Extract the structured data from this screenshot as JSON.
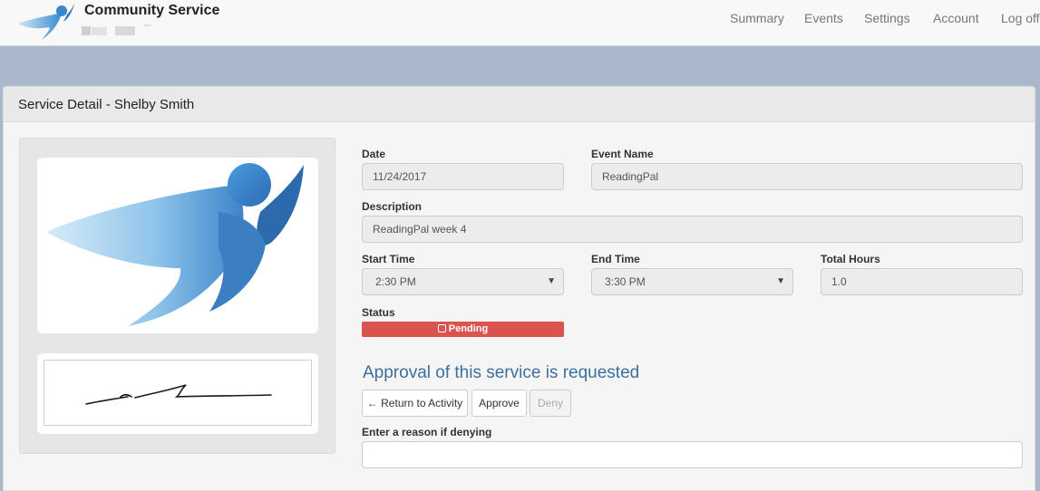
{
  "header": {
    "app_title": "Community Service",
    "logo_icon": "flying-figure-logo",
    "nav": [
      "Summary",
      "Events",
      "Settings",
      "Account",
      "Log off"
    ]
  },
  "panel": {
    "title": "Service Detail - Shelby Smith"
  },
  "form": {
    "date_label": "Date",
    "date_value": "11/24/2017",
    "event_name_label": "Event Name",
    "event_name_value": "ReadingPal",
    "description_label": "Description",
    "description_value": "ReadingPal week 4",
    "start_time_label": "Start Time",
    "start_time_value": "2:30 PM",
    "end_time_label": "End Time",
    "end_time_value": "3:30 PM",
    "total_hours_label": "Total Hours",
    "total_hours_value": "1.0",
    "status_label": "Status",
    "status_value": "Pending"
  },
  "approval": {
    "heading": "Approval of this service is requested",
    "return_label": "Return to Activity",
    "approve_label": "Approve",
    "deny_label": "Deny",
    "reason_label": "Enter a reason if denying"
  },
  "colors": {
    "status_pending": "#d9534f",
    "heading_blue": "#3c6f9c"
  }
}
